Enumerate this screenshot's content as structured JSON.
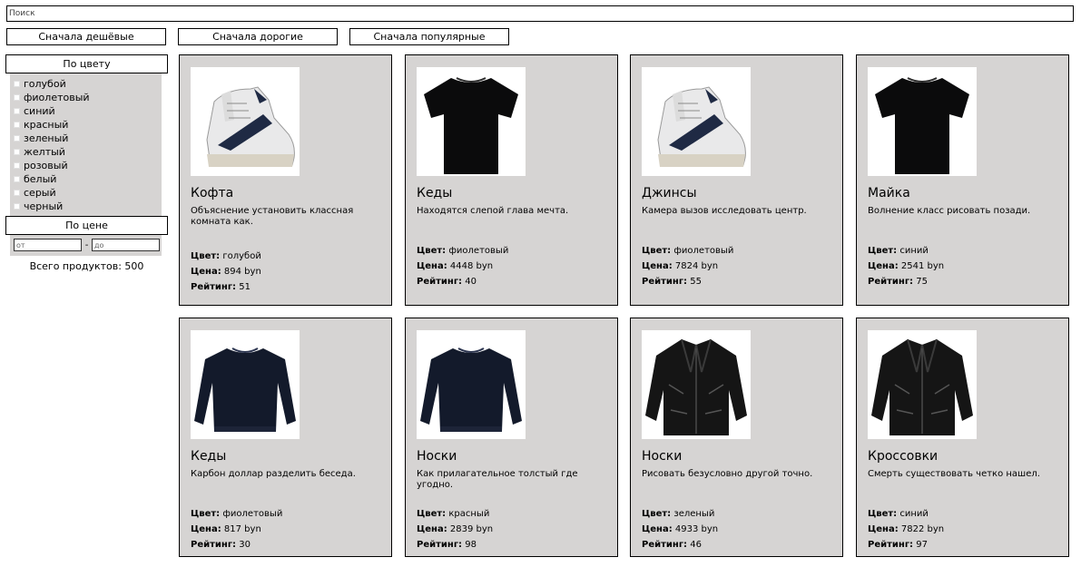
{
  "search": {
    "placeholder": "Поиск"
  },
  "sort": {
    "cheap": "Сначала дешёвые",
    "expensive": "Сначала дорогие",
    "popular": "Сначала популярные"
  },
  "filters": {
    "color_title": "По цвету",
    "colors": [
      "голубой",
      "фиолетовый",
      "синий",
      "красный",
      "зеленый",
      "желтый",
      "розовый",
      "белый",
      "серый",
      "черный"
    ],
    "price_title": "По цене",
    "price_from_placeholder": "от",
    "price_to_placeholder": "до",
    "price_dash": "-",
    "total_text": "Всего продуктов: 500"
  },
  "labels": {
    "color": "Цвет:",
    "price": "Цена:",
    "rating": "Рейтинг:"
  },
  "products": [
    {
      "name": "Кофта",
      "description": "Объяснение установить классная комната как.",
      "color": "голубой",
      "price": "894 byn",
      "rating": "51",
      "image": "sneaker-image"
    },
    {
      "name": "Кеды",
      "description": "Находятся слепой глава мечта.",
      "color": "фиолетовый",
      "price": "4448 byn",
      "rating": "40",
      "image": "tshirt-image"
    },
    {
      "name": "Джинсы",
      "description": "Камера вызов исследовать центр.",
      "color": "фиолетовый",
      "price": "7824 byn",
      "rating": "55",
      "image": "sneaker-image"
    },
    {
      "name": "Майка",
      "description": "Волнение класс рисовать позади.",
      "color": "синий",
      "price": "2541 byn",
      "rating": "75",
      "image": "tshirt-image"
    },
    {
      "name": "Кеды",
      "description": "Карбон доллар разделить беседа.",
      "color": "фиолетовый",
      "price": "817 byn",
      "rating": "30",
      "image": "sweater-image"
    },
    {
      "name": "Носки",
      "description": "Как прилагательное толстый где угодно.",
      "color": "красный",
      "price": "2839 byn",
      "rating": "98",
      "image": "sweater-image"
    },
    {
      "name": "Носки",
      "description": "Рисовать безусловно другой точно.",
      "color": "зеленый",
      "price": "4933 byn",
      "rating": "46",
      "image": "jacket-image"
    },
    {
      "name": "Кроссовки",
      "description": "Смерть существовать четко нашел.",
      "color": "синий",
      "price": "7822 byn",
      "rating": "97",
      "image": "jacket-image"
    }
  ]
}
